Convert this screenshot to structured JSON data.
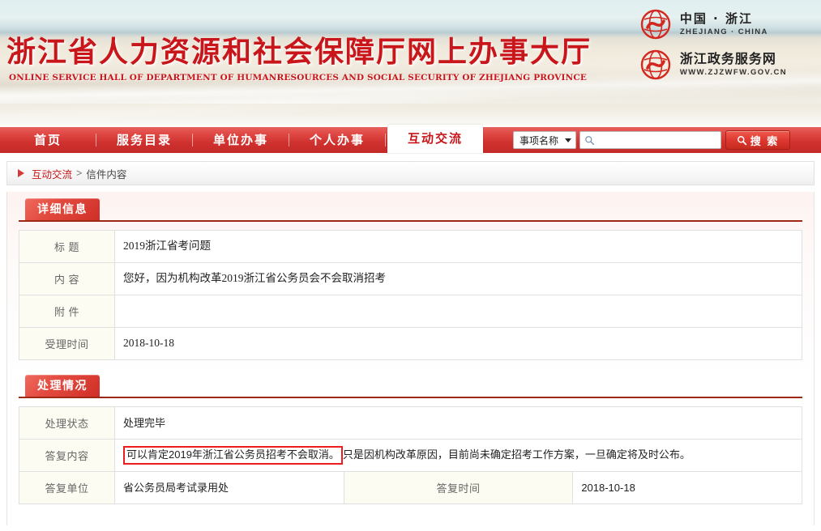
{
  "site": {
    "title": "浙江省人力资源和社会保障厅网上办事大厅",
    "subtitle": "ONLINE SERVICE HALL OF DEPARTMENT OF HUMANRESOURCES AND SOCIAL SECURITY OF ZHEJIANG PROVINCE",
    "accent_color": "#c8161a",
    "nav_color": "#cf312e"
  },
  "logos": [
    {
      "cn": "中国 · 浙江",
      "en": "ZHEJIANG · CHINA",
      "mark": "zhejiang-china-logo-icon"
    },
    {
      "cn": "浙江政务服务网",
      "en": "WWW.ZJZWFW.GOV.CN",
      "mark": "zjzwfw-logo-icon"
    }
  ],
  "nav": {
    "items": [
      {
        "label": "首页",
        "active": false
      },
      {
        "label": "服务目录",
        "active": false
      },
      {
        "label": "单位办事",
        "active": false
      },
      {
        "label": "个人办事",
        "active": false
      }
    ],
    "active_tab": "互动交流"
  },
  "search": {
    "select_value": "事项名称",
    "input_value": "",
    "placeholder": "",
    "button_label": "搜 索",
    "search_icon": "magnifier-icon"
  },
  "breadcrumb": {
    "arrow_icon": "triangle-right-icon",
    "parent": "互动交流",
    "separator": ">",
    "current": "信件内容"
  },
  "sections": [
    {
      "tab_label": "详细信息",
      "rows": [
        {
          "label": "标    题",
          "value": "2019浙江省考问题"
        },
        {
          "label": "内    容",
          "value": "您好，因为机构改革2019浙江省公务员会不会取消招考"
        },
        {
          "label": "附    件",
          "value": ""
        },
        {
          "label": "受理时间",
          "value": "2018-10-18"
        }
      ]
    },
    {
      "tab_label": "处理情况",
      "rows": [
        {
          "label": "处理状态",
          "value": "处理完毕"
        },
        {
          "label": "答复内容",
          "highlighted": "可以肯定2019年浙江省公务员招考不会取消。",
          "value": "只是因机构改革原因，目前尚未确定招考工作方案，一旦确定将及时公布。"
        }
      ],
      "last_row": {
        "label1": "答复单位",
        "value1": "省公务员局考试录用处",
        "label2": "答复时间",
        "value2": "2018-10-18"
      }
    }
  ]
}
